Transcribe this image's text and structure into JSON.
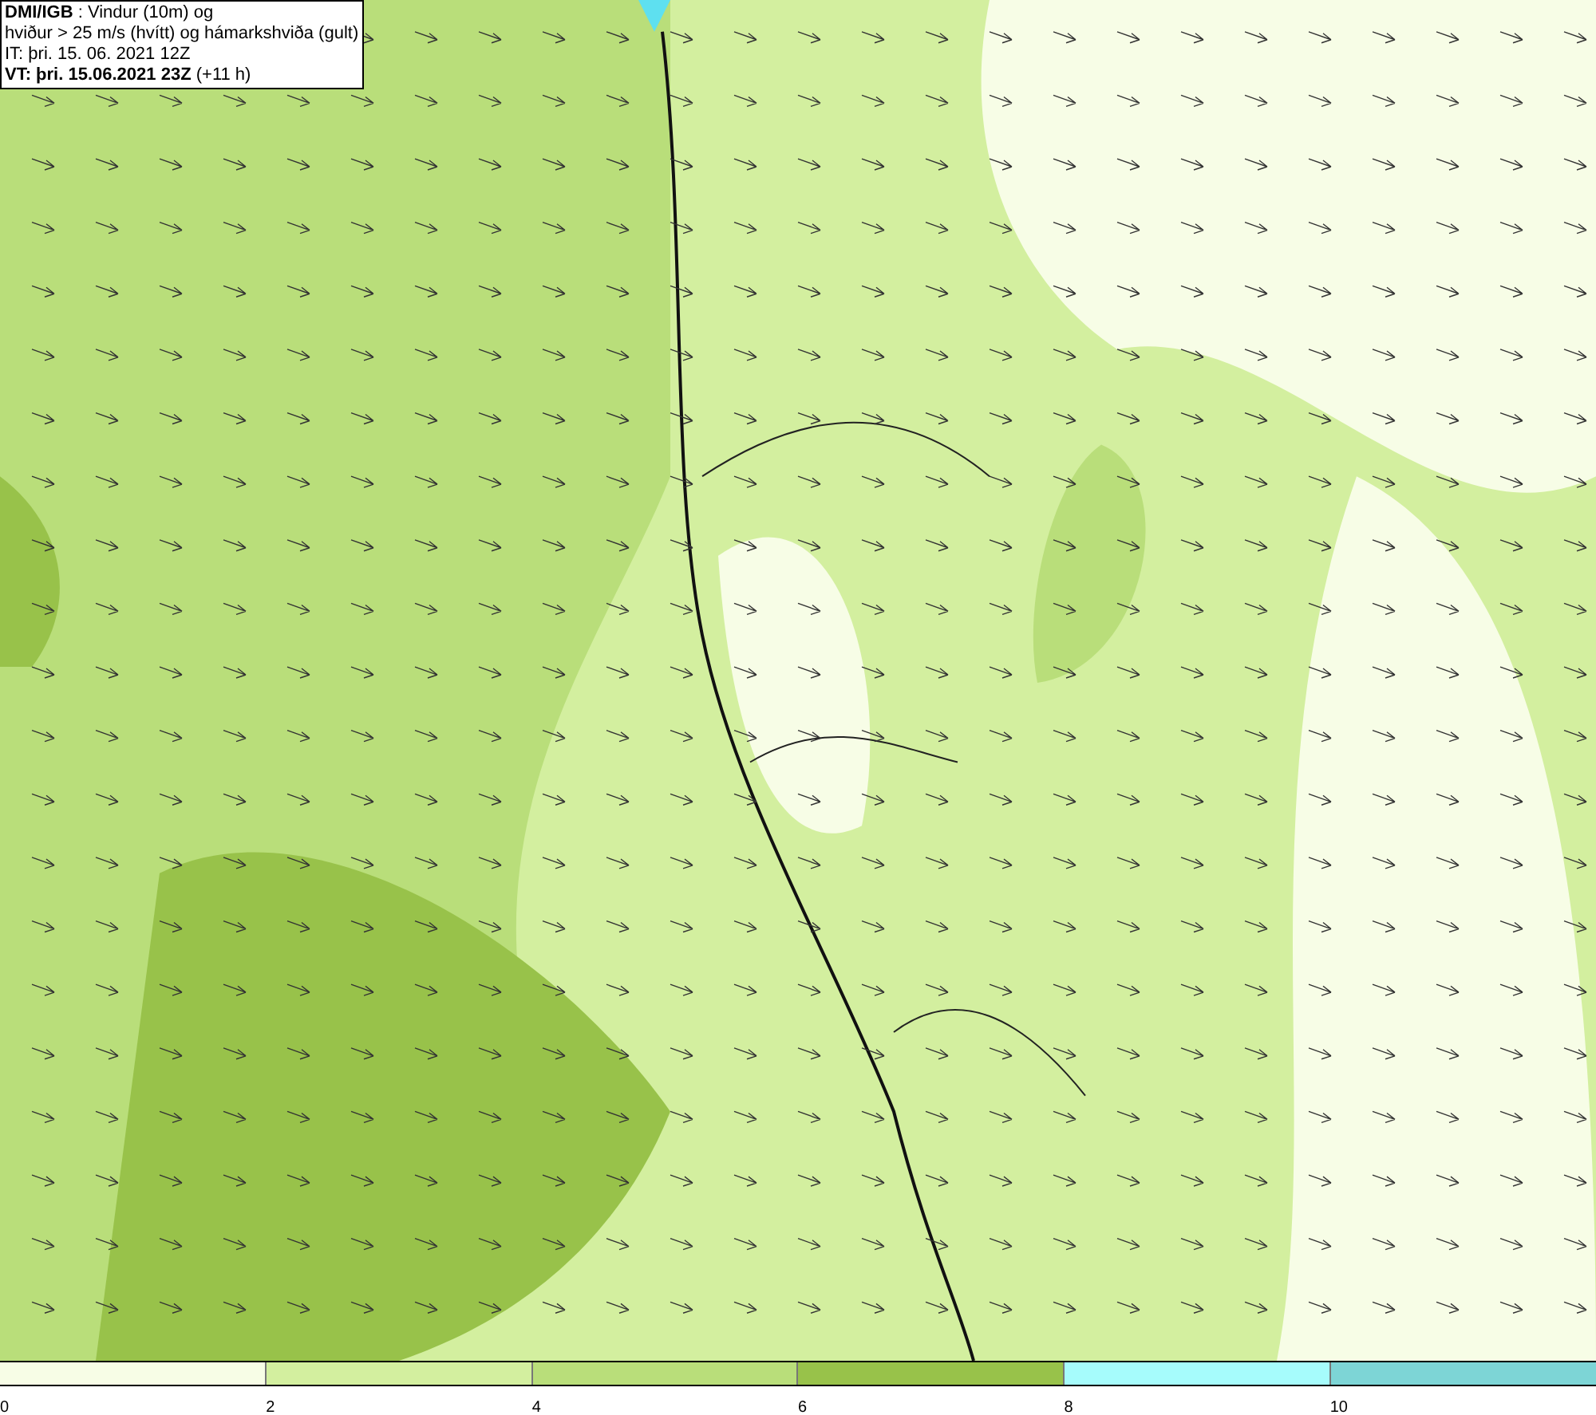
{
  "info_box": {
    "lines": [
      "**DMI/IGB** : Vindur (10m) og",
      "hviður > 25 m/s (hvítt) og hámarkshviða (gult)",
      "IT: þri. 15. 06. 2021 12Z",
      "**VT: þri. 15.06.2021 23Z** (+11 h)"
    ]
  },
  "legend": {
    "segments": [
      {
        "color": "#f7fde6"
      },
      {
        "color": "#d3ef9f"
      },
      {
        "color": "#b9de7a"
      },
      {
        "color": "#98c24a"
      },
      {
        "color": "#a6fcfc"
      },
      {
        "color": "#7dd5d6"
      }
    ],
    "labels": [
      "0",
      "2",
      "4",
      "6",
      "8",
      "10"
    ]
  }
}
